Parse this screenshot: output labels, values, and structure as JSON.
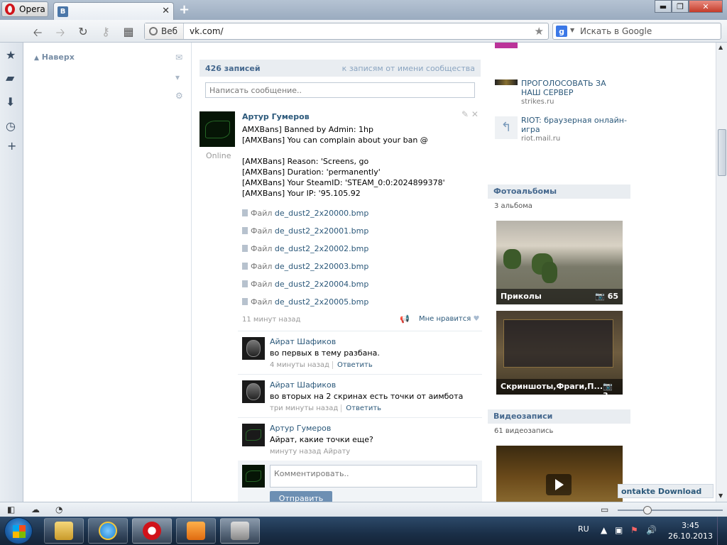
{
  "browser": {
    "menu_label": "Opera",
    "tab_favicon": "В",
    "tab_close": "✕",
    "new_tab": "+",
    "win_min": "▬",
    "win_restore": "❐",
    "win_close": "✕",
    "address": {
      "scheme_label": "Веб",
      "url": "vk.com/"
    },
    "search_placeholder": "Искать в Google",
    "search_engine_icon": "g"
  },
  "left_column": {
    "back_to_top": "Наверх"
  },
  "wall": {
    "count": "426 записей",
    "community_link": "к записям от имени сообщества",
    "message_placeholder": "Написать сообщение.."
  },
  "post": {
    "author": "Артур Гумеров",
    "status": "Online",
    "lines": [
      "AMXBans] Banned by Admin: 1hp",
      "[AMXBans] You can complain about your ban @",
      "[AMXBans] Reason: 'Screens, go",
      "[AMXBans] Duration: 'permanently'",
      "[AMXBans] Your SteamID: 'STEAM_0:0:2024899378'",
      "[AMXBans] Your IP: '95.105.92"
    ],
    "file_prefix": "Файл",
    "files": [
      "de_dust2_2x20000.bmp",
      "de_dust2_2x20001.bmp",
      "de_dust2_2x20002.bmp",
      "de_dust2_2x20003.bmp",
      "de_dust2_2x20004.bmp",
      "de_dust2_2x20005.bmp"
    ],
    "time": "11 минут назад",
    "like_label": "Мне нравится"
  },
  "comments": [
    {
      "author": "Айрат Шафиков",
      "text": "во первых в тему разбана.",
      "time": "4 минуты назад",
      "reply": "Ответить"
    },
    {
      "author": "Айрат Шафиков",
      "text": "во вторых на 2 скринах есть точки от аимбота",
      "time": "три минуты назад",
      "reply": "Ответить"
    },
    {
      "author": "Артур Гумеров",
      "text": "Айрат, какие точки еще?",
      "time": "минуту назад Айрату",
      "reply": ""
    }
  ],
  "reply_box": {
    "placeholder": "Комментировать..",
    "send_label": "Отправить"
  },
  "right_column": {
    "ads": [
      {
        "title": "ПРОГОЛОСОВАТЬ ЗА НАШ СЕРВЕР",
        "domain": "strikes.ru"
      },
      {
        "title": "RIOT: браузерная онлайн-игра",
        "domain": "riot.mail.ru"
      }
    ],
    "albums_header": "Фотоальбомы",
    "albums_count": "3 альбома",
    "albums": [
      {
        "name": "Приколы",
        "count": "65"
      },
      {
        "name": "Скриншоты,Фраги,П...",
        "count": "3"
      }
    ],
    "videos_header": "Видеозаписи",
    "videos_count": "61 видеозапись",
    "download_label": "ontakte Download"
  },
  "taskbar": {
    "lang": "RU",
    "time": "3:45",
    "date": "26.10.2013"
  },
  "colors": {
    "vk_blue": "#45688e",
    "link": "#2b587a",
    "opera_red": "#d0131a"
  }
}
